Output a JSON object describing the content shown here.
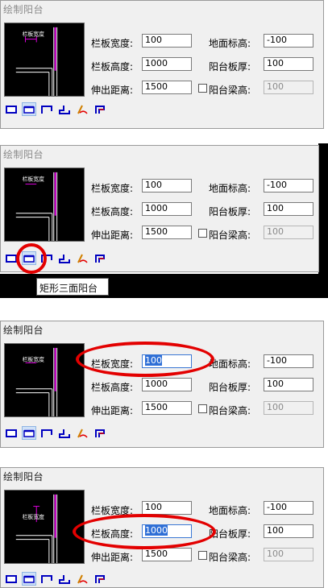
{
  "window_title": "绘制阳台",
  "labels": {
    "board_width": "栏板宽度:",
    "board_height": "栏板高度:",
    "extend_distance": "伸出距离:",
    "ground_elevation": "地面标高:",
    "slab_thickness": "阳台板厚:",
    "beam_height": "阳台梁高:"
  },
  "values": {
    "board_width": "100",
    "board_height": "1000",
    "extend_distance": "1500",
    "ground_elevation": "-100",
    "slab_thickness": "100",
    "beam_height": "100"
  },
  "preview_text": "栏板宽度",
  "tooltip": "矩形三面阳台",
  "toolbar_icons": [
    "rect-balcony-icon",
    "rect-three-sided-balcony-icon",
    "three-sided-balcony-icon",
    "corner-balcony-icon",
    "freehand-balcony-icon",
    "custom-balcony-icon"
  ],
  "colors": {
    "magenta": "#e000e0",
    "annotation_red": "#e30000",
    "selection_blue": "#2f6fd6"
  }
}
